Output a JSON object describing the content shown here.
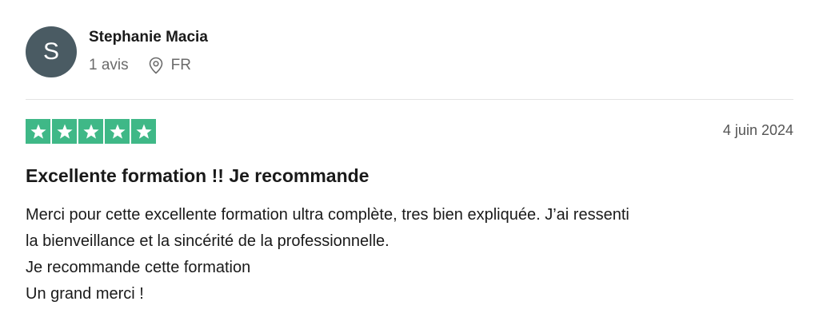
{
  "reviewer": {
    "initial": "S",
    "name": "Stephanie Macia",
    "reviews_count": "1 avis",
    "location_icon": "location-pin-icon",
    "country": "FR",
    "avatar_color": "#4a5b63"
  },
  "review": {
    "rating": 5,
    "rating_max": 5,
    "star_color": "#3fb887",
    "date": "4 juin 2024",
    "title": "Excellente formation !! Je recommande",
    "body_lines": [
      "Merci pour cette excellente formation ultra complète, tres bien expliquée. J’ai ressenti",
      "la bienveillance et la sincérité de la professionnelle.",
      "Je recommande cette formation",
      "Un grand merci !"
    ]
  }
}
